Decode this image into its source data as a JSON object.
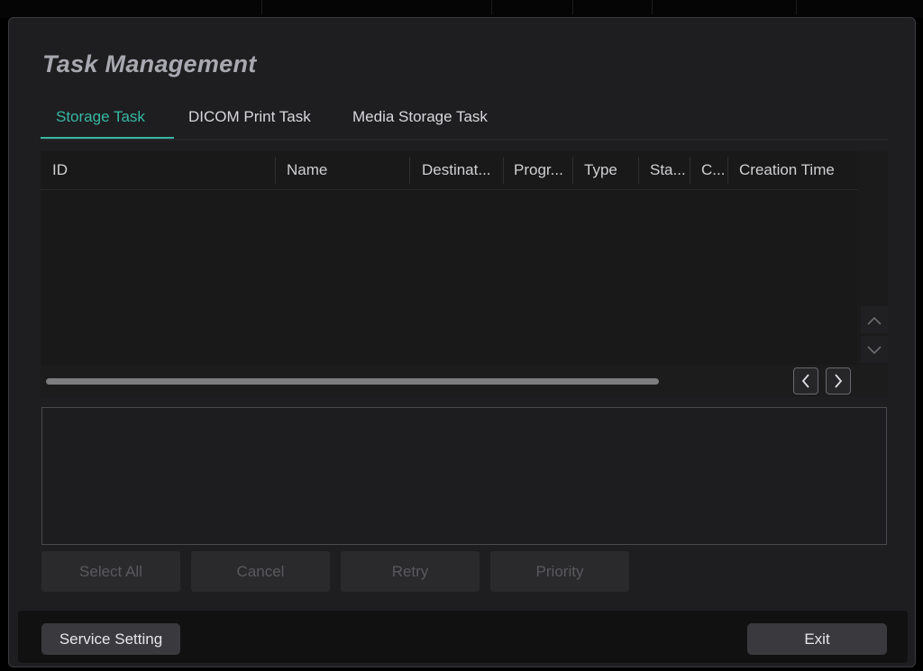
{
  "dialog": {
    "title": "Task Management"
  },
  "tabs": [
    {
      "label": "Storage Task",
      "active": true
    },
    {
      "label": "DICOM Print Task",
      "active": false
    },
    {
      "label": "Media Storage Task",
      "active": false
    }
  ],
  "table": {
    "columns": [
      "ID",
      "Name",
      "Destinat...",
      "Progr...",
      "Type",
      "Sta...",
      "C...",
      "Creation Time"
    ],
    "rows": []
  },
  "scroll_buttons": {
    "up_icon": "chevron-up-icon",
    "down_icon": "chevron-down-icon",
    "left_icon": "chevron-left-icon",
    "right_icon": "chevron-right-icon"
  },
  "actions": {
    "select_all": "Select All",
    "cancel": "Cancel",
    "retry": "Retry",
    "priority": "Priority"
  },
  "footer": {
    "service_setting": "Service Setting",
    "exit": "Exit"
  },
  "colors": {
    "accent": "#37b8a4",
    "dialog_bg": "#1e1e20"
  }
}
